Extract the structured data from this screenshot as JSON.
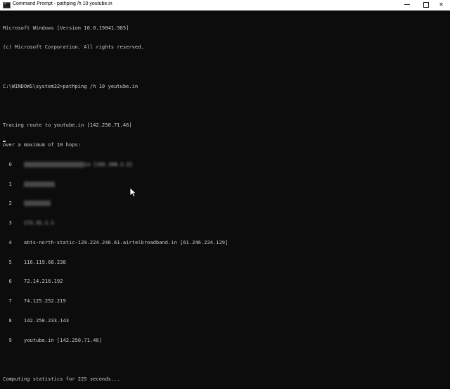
{
  "window": {
    "title": "Command Prompt - pathping /h 10 youtube.in"
  },
  "controls": {
    "close": "✕"
  },
  "console": {
    "header": [
      "Microsoft Windows [Version 10.0.19041.985]",
      "(c) Microsoft Corporation. All rights reserved."
    ],
    "command": "C:\\WINDOWS\\system32>pathping /h 10 youtube.in",
    "trace": [
      "Tracing route to youtube.in [142.250.71.46]",
      "over a maximum of 10 hops:"
    ],
    "hops": [
      {
        "num": "0",
        "text": "in [192.168.2.2]",
        "redacted": true
      },
      {
        "num": "1",
        "text": "",
        "redacted": true
      },
      {
        "num": "2",
        "text": "",
        "redacted": true
      },
      {
        "num": "3",
        "text": "172.31.1.1",
        "redacted": true
      },
      {
        "num": "4",
        "text": "abts-north-static-129.224.246.61.airtelbroadband.in [61.246.224.129]",
        "redacted": false
      },
      {
        "num": "5",
        "text": "116.119.68.238",
        "redacted": false
      },
      {
        "num": "6",
        "text": "72.14.216.192",
        "redacted": false
      },
      {
        "num": "7",
        "text": "74.125.252.219",
        "redacted": false
      },
      {
        "num": "8",
        "text": "142.250.233.143",
        "redacted": false
      },
      {
        "num": "9",
        "text": "youtube.in [142.250.71.46]",
        "redacted": false
      }
    ],
    "status": "Computing statistics for 225 seconds..."
  },
  "icons": {
    "app": "command-prompt-icon",
    "cursor": "mouse-pointer-icon"
  }
}
